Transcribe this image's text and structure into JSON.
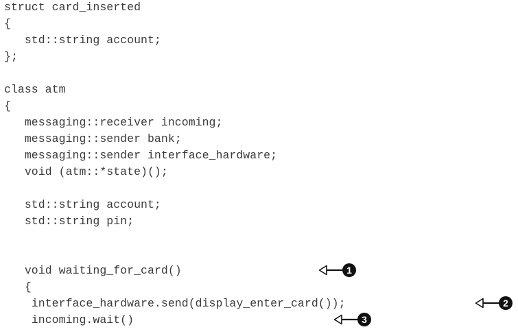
{
  "code": {
    "lines": [
      "struct card_inserted",
      "{",
      "   std::string account;",
      "};",
      "",
      "class atm",
      "{",
      "   messaging::receiver incoming;",
      "   messaging::sender bank;",
      "   messaging::sender interface_hardware;",
      "   void (atm::*state)();",
      "",
      "   std::string account;",
      "   std::string pin;",
      "",
      "   void waiting_for_card()",
      "   {",
      "    interface_hardware.send(display_enter_card());",
      "    incoming.wait()"
    ]
  },
  "callouts": [
    {
      "number": "1",
      "icon": "left-arrow-icon"
    },
    {
      "number": "2",
      "icon": "left-arrow-icon"
    },
    {
      "number": "3",
      "icon": "left-arrow-icon"
    }
  ]
}
